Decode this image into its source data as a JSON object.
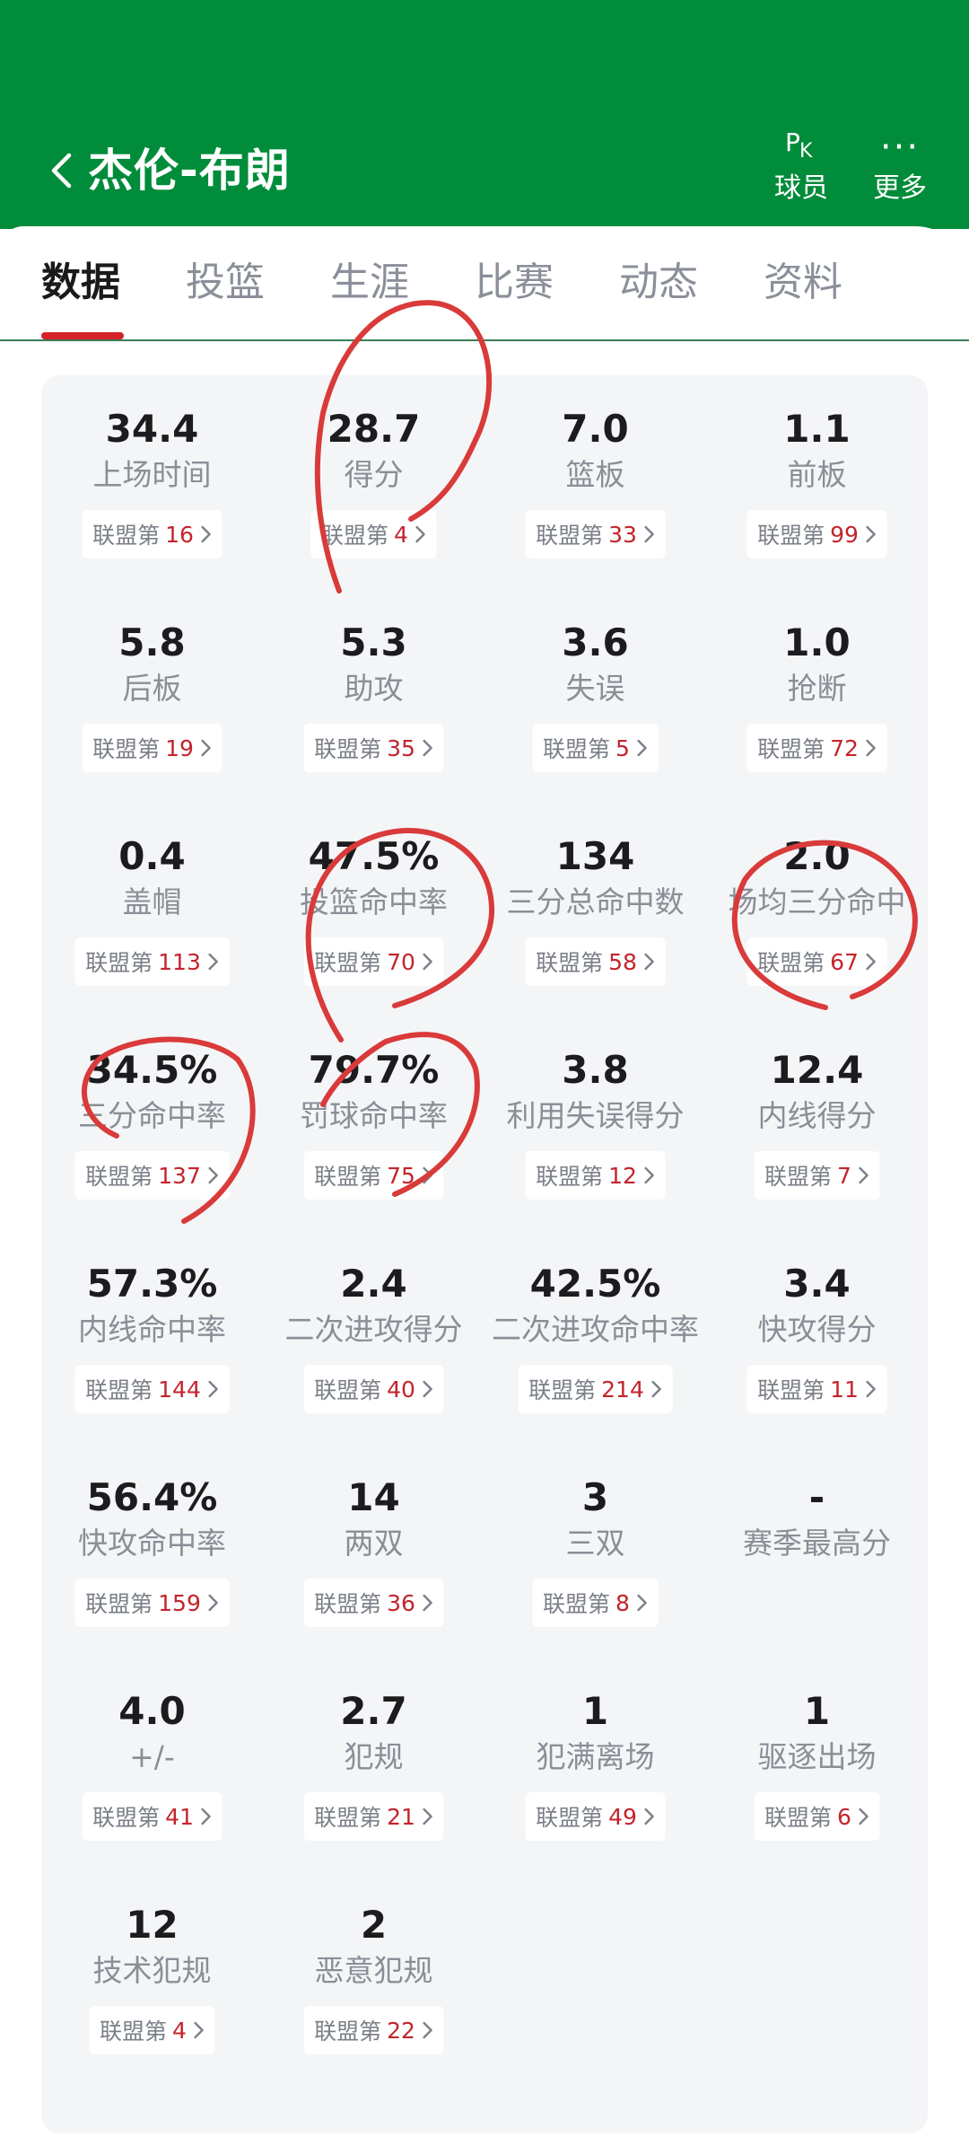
{
  "header": {
    "player_name": "杰伦-布朗",
    "pk_button": {
      "label": "球员",
      "icon": "pk-icon"
    },
    "more_button": {
      "label": "更多",
      "icon": "more-dots-icon"
    }
  },
  "tabs": [
    {
      "label": "数据",
      "active": true
    },
    {
      "label": "投篮",
      "active": false
    },
    {
      "label": "生涯",
      "active": false
    },
    {
      "label": "比赛",
      "active": false
    },
    {
      "label": "动态",
      "active": false
    },
    {
      "label": "资料",
      "active": false
    }
  ],
  "rank_prefix": "联盟第",
  "colors": {
    "header_green": "#008c3a",
    "rank_red": "#c3242c",
    "tab_active_red": "#d42027",
    "annotation_red": "#d93a3a"
  },
  "stats": [
    {
      "value": "34.4",
      "name": "上场时间",
      "rank": "16"
    },
    {
      "value": "28.7",
      "name": "得分",
      "rank": "4"
    },
    {
      "value": "7.0",
      "name": "篮板",
      "rank": "33"
    },
    {
      "value": "1.1",
      "name": "前板",
      "rank": "99"
    },
    {
      "value": "5.8",
      "name": "后板",
      "rank": "19"
    },
    {
      "value": "5.3",
      "name": "助攻",
      "rank": "35"
    },
    {
      "value": "3.6",
      "name": "失误",
      "rank": "5"
    },
    {
      "value": "1.0",
      "name": "抢断",
      "rank": "72"
    },
    {
      "value": "0.4",
      "name": "盖帽",
      "rank": "113"
    },
    {
      "value": "47.5%",
      "name": "投篮命中率",
      "rank": "70"
    },
    {
      "value": "134",
      "name": "三分总命中数",
      "rank": "58"
    },
    {
      "value": "2.0",
      "name": "场均三分命中",
      "rank": "67"
    },
    {
      "value": "34.5%",
      "name": "三分命中率",
      "rank": "137"
    },
    {
      "value": "79.7%",
      "name": "罚球命中率",
      "rank": "75"
    },
    {
      "value": "3.8",
      "name": "利用失误得分",
      "rank": "12"
    },
    {
      "value": "12.4",
      "name": "内线得分",
      "rank": "7"
    },
    {
      "value": "57.3%",
      "name": "内线命中率",
      "rank": "144"
    },
    {
      "value": "2.4",
      "name": "二次进攻得分",
      "rank": "40"
    },
    {
      "value": "42.5%",
      "name": "二次进攻命中率",
      "rank": "214"
    },
    {
      "value": "3.4",
      "name": "快攻得分",
      "rank": "11"
    },
    {
      "value": "56.4%",
      "name": "快攻命中率",
      "rank": "159"
    },
    {
      "value": "14",
      "name": "两双",
      "rank": "36"
    },
    {
      "value": "3",
      "name": "三双",
      "rank": "8"
    },
    {
      "value": "-",
      "name": "赛季最高分",
      "rank": null
    },
    {
      "value": "4.0",
      "name": "+/-",
      "rank": "41"
    },
    {
      "value": "2.7",
      "name": "犯规",
      "rank": "21"
    },
    {
      "value": "1",
      "name": "犯满离场",
      "rank": "49"
    },
    {
      "value": "1",
      "name": "驱逐出场",
      "rank": "6"
    },
    {
      "value": "12",
      "name": "技术犯规",
      "rank": "4"
    },
    {
      "value": "2",
      "name": "恶意犯规",
      "rank": "22"
    }
  ]
}
